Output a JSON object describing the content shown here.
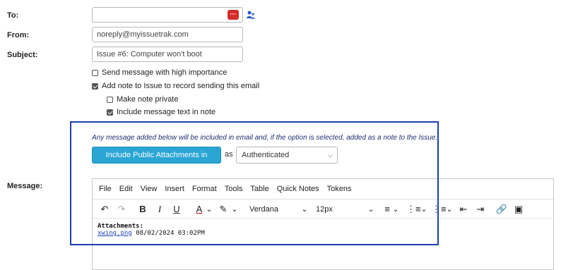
{
  "form": {
    "to_label": "To:",
    "to_value": "",
    "from_label": "From:",
    "from_value": "noreply@myissuetrak.com",
    "subject_label": "Subject:",
    "subject_value": "Issue #6: Computer won't boot",
    "message_label": "Message:"
  },
  "options": {
    "high_importance": {
      "label": "Send message with high importance",
      "checked": false
    },
    "add_note": {
      "label": "Add note to Issue to record sending this email",
      "checked": true
    },
    "private_note": {
      "label": "Make note private",
      "checked": false
    },
    "include_text": {
      "label": "Include message text in note",
      "checked": true
    }
  },
  "attachments_panel": {
    "note": "Any message added below will be included in email and, if the option is selected, added as a note to the Issue.",
    "button_label": "Include Public Attachments in Message",
    "as_label": "as",
    "select_value": "Authenticated"
  },
  "editor": {
    "menu": [
      "File",
      "Edit",
      "View",
      "Insert",
      "Format",
      "Tools",
      "Table",
      "Quick Notes",
      "Tokens"
    ],
    "font_family": "Verdana",
    "font_size": "12px",
    "content_heading": "Attachments:",
    "attachment_link": "xwing.png",
    "attachment_date": "08/02/2024 03:02PM"
  },
  "colors": {
    "accent": "#2aa5d4",
    "frame": "#1b3fae",
    "dots_button": "#d62b2b"
  }
}
